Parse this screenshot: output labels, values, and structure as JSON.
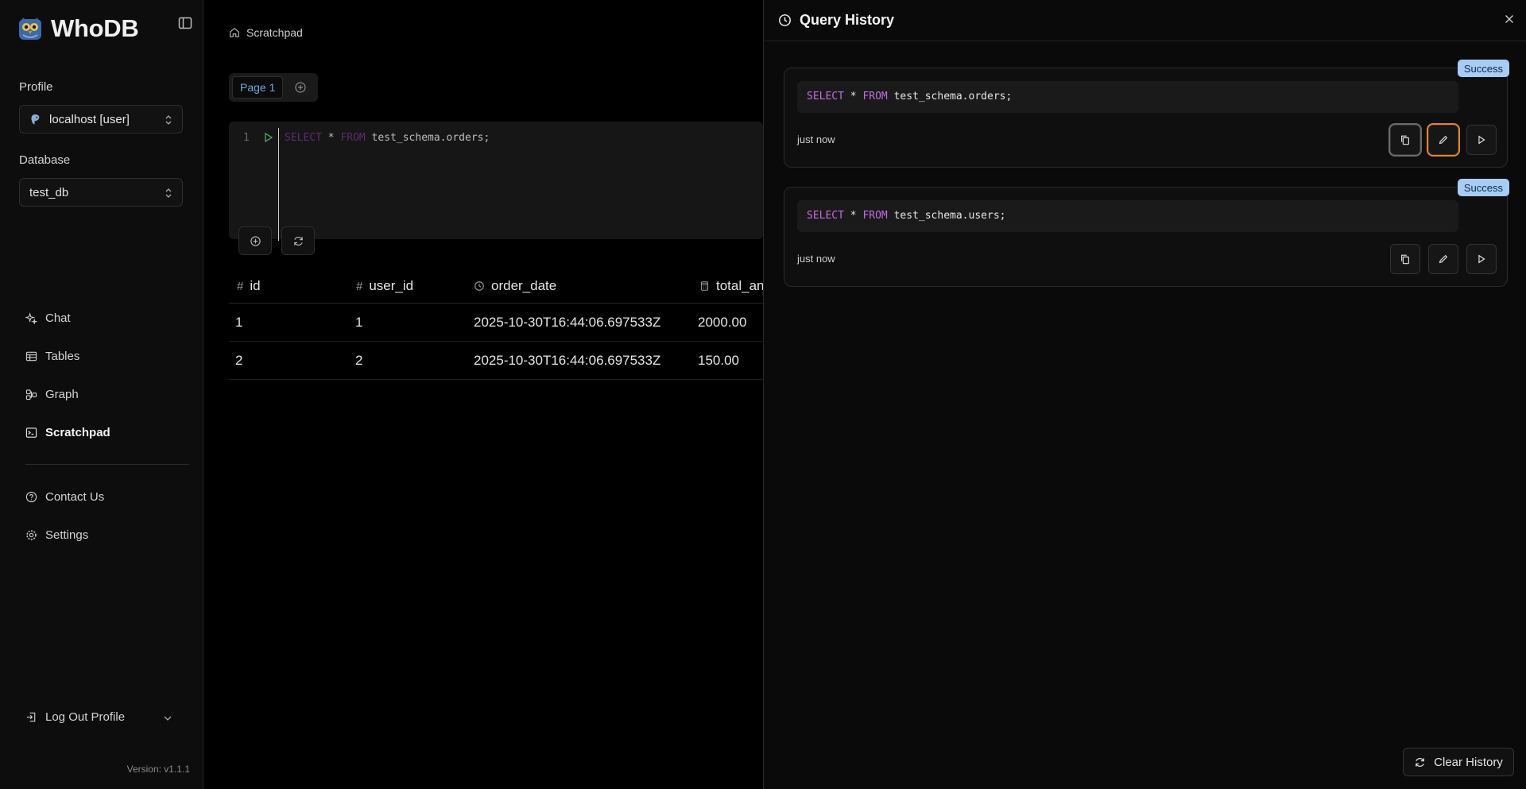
{
  "app": {
    "name": "WhoDB",
    "version": "Version: v1.1.1"
  },
  "sidebar": {
    "profile_label": "Profile",
    "profile_value": "localhost [user]",
    "database_label": "Database",
    "database_value": "test_db",
    "nav": [
      {
        "label": "Chat",
        "icon": "sparkles-icon"
      },
      {
        "label": "Tables",
        "icon": "table-icon"
      },
      {
        "label": "Graph",
        "icon": "graph-icon"
      },
      {
        "label": "Scratchpad",
        "icon": "scratchpad-icon",
        "active": true
      }
    ],
    "secondary": [
      {
        "label": "Contact Us",
        "icon": "help-circle-icon"
      },
      {
        "label": "Settings",
        "icon": "gear-icon"
      }
    ],
    "logout_label": "Log Out Profile"
  },
  "main": {
    "breadcrumb": "Scratchpad",
    "page_tab": "Page 1",
    "editor": {
      "line_number": "1",
      "kw1": "SELECT",
      "star": " * ",
      "kw2": "FROM",
      "rest": " test_schema.orders;"
    },
    "table": {
      "columns": [
        {
          "label": "id",
          "icon": "#"
        },
        {
          "label": "user_id",
          "icon": "#"
        },
        {
          "label": "order_date",
          "icon": "clock-icon"
        },
        {
          "label": "total_an",
          "icon": "calculator-icon"
        }
      ],
      "rows": [
        [
          "1",
          "1",
          "2025-10-30T16:44:06.697533Z",
          "2000.00"
        ],
        [
          "2",
          "2",
          "2025-10-30T16:44:06.697533Z",
          "150.00"
        ]
      ]
    }
  },
  "history": {
    "title": "Query History",
    "clear_label": "Clear History",
    "items": [
      {
        "kw1": "SELECT",
        "star": " * ",
        "kw2": "FROM",
        "rest": " test_schema.orders;",
        "status": "Success",
        "time": "just now"
      },
      {
        "kw1": "SELECT",
        "star": " * ",
        "kw2": "FROM",
        "rest": " test_schema.users;",
        "status": "Success",
        "time": "just now"
      }
    ]
  },
  "colors": {
    "accent": "#6fa8dc",
    "badge": "#a7cdf5",
    "focus": "#e6842a",
    "keyword": "#c06de0"
  }
}
